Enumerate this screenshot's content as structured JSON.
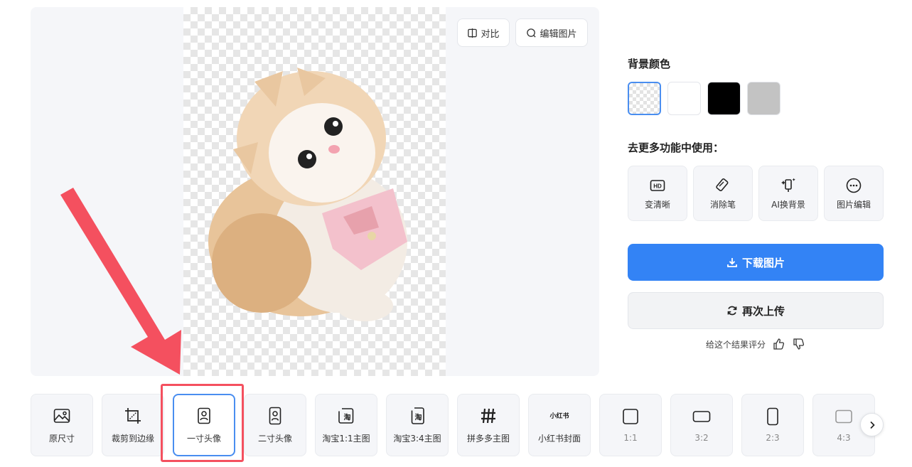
{
  "preview": {
    "compare_label": "对比",
    "edit_label": "编辑图片"
  },
  "background": {
    "title": "背景颜色",
    "swatches": [
      {
        "name": "transparent",
        "color": "transparent",
        "selected": true
      },
      {
        "name": "white",
        "color": "#ffffff",
        "selected": false
      },
      {
        "name": "black",
        "color": "#000000",
        "selected": false
      },
      {
        "name": "gray",
        "color": "#c3c3c3",
        "selected": false
      }
    ]
  },
  "more": {
    "title": "去更多功能中使用：",
    "tools": [
      {
        "icon": "hd-icon",
        "label": "变清晰"
      },
      {
        "icon": "eraser-icon",
        "label": "消除笔"
      },
      {
        "icon": "ai-background-icon",
        "label": "AI换背景"
      },
      {
        "icon": "more-circle-icon",
        "label": "图片编辑"
      }
    ]
  },
  "actions": {
    "download_label": "下载图片",
    "reupload_label": "再次上传",
    "rate_label": "给这个结果评分"
  },
  "sizes": [
    {
      "icon": "image-icon",
      "label": "原尺寸"
    },
    {
      "icon": "crop-icon",
      "label": "裁剪到边缘"
    },
    {
      "icon": "portrait-icon",
      "label": "一寸头像",
      "selected": true
    },
    {
      "icon": "portrait-tall-icon",
      "label": "二寸头像"
    },
    {
      "icon": "taobao-icon",
      "label": "淘宝1:1主图",
      "badge": "淘"
    },
    {
      "icon": "taobao-tall-icon",
      "label": "淘宝3:4主图",
      "badge": "淘"
    },
    {
      "icon": "pinduoduo-icon",
      "label": "拼多多主图"
    },
    {
      "icon": "xiaohongshu-icon",
      "label": "小红书封面",
      "badge": "小红书"
    },
    {
      "icon": "square-ratio-icon",
      "label": "1:1"
    },
    {
      "icon": "landscape-ratio-icon",
      "label": "3:2"
    },
    {
      "icon": "portrait-ratio-icon",
      "label": "2:3"
    },
    {
      "icon": "landscape-ratio-icon",
      "label": "4:3"
    }
  ],
  "colors": {
    "accent": "#3383f5",
    "highlight": "#f4505f"
  }
}
